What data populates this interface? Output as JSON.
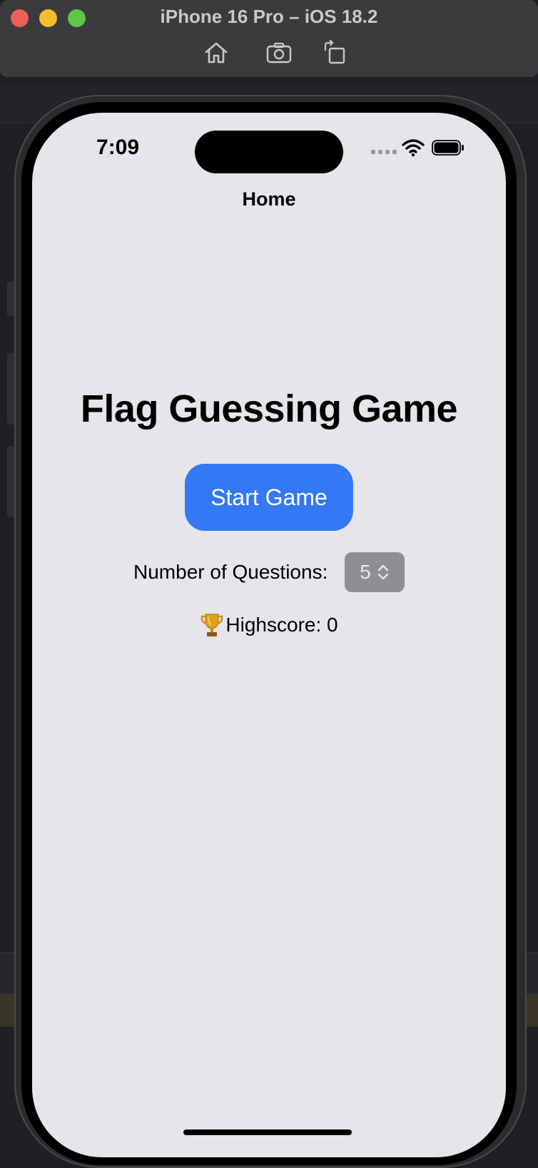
{
  "window": {
    "title": "iPhone 16 Pro – iOS 18.2",
    "toolbar_icons": [
      "home-icon",
      "screenshot-icon",
      "rotate-icon"
    ]
  },
  "status_bar": {
    "time": "7:09",
    "icons": [
      "cellular-signal-icon",
      "wifi-icon",
      "battery-icon"
    ]
  },
  "nav": {
    "title": "Home"
  },
  "main": {
    "title": "Flag Guessing Game",
    "start_button_label": "Start Game",
    "questions_label": "Number of Questions:",
    "questions_value": "5",
    "highscore_text": "Highscore: 0"
  },
  "colors": {
    "accent": "#3478f6",
    "screen_background": "#e5e5ea",
    "stepper_background": "#8e8e93"
  }
}
